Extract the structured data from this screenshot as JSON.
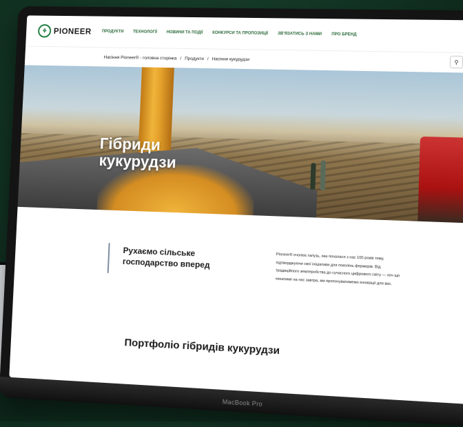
{
  "site": {
    "logo": "PIONEER",
    "nav": [
      "ПРОДУКТИ",
      "ТЕХНОЛОГІЇ",
      "НОВИНИ ТА ПОДІЇ",
      "КОНКУРСИ ТА ПРОПОЗИЦІЇ",
      "ЗВ'ЯЗАТИСЬ З НАМИ",
      "ПРО БРЕНД"
    ],
    "breadcrumb": [
      "Насіння Pioneer® - головна сторінка",
      "/",
      "Продукти",
      "/",
      "Насіння кукурудзи"
    ]
  },
  "hero": {
    "title_line1": "Гібриди",
    "title_line2": "кукурудзи"
  },
  "intro": {
    "heading_line1": "Рухаємо сільське",
    "heading_line2": "господарство вперед",
    "body": "Pioneer® очолює галузь, яка почалася з нас 100 років тому, підтверджуючи свої ініціативи для поколінь фермерів. Від традиційного землеробства до сучасного цифрового світу — хоч що чекатиме на нас завтра, ми пропонуватимемо інновації для вас."
  },
  "portfolio_title": "Портфоліо гібридів кукурудзи",
  "device_label": "MacBook Pro",
  "colors": {
    "background": "#133826",
    "brand_green": "#2d6b3a"
  }
}
